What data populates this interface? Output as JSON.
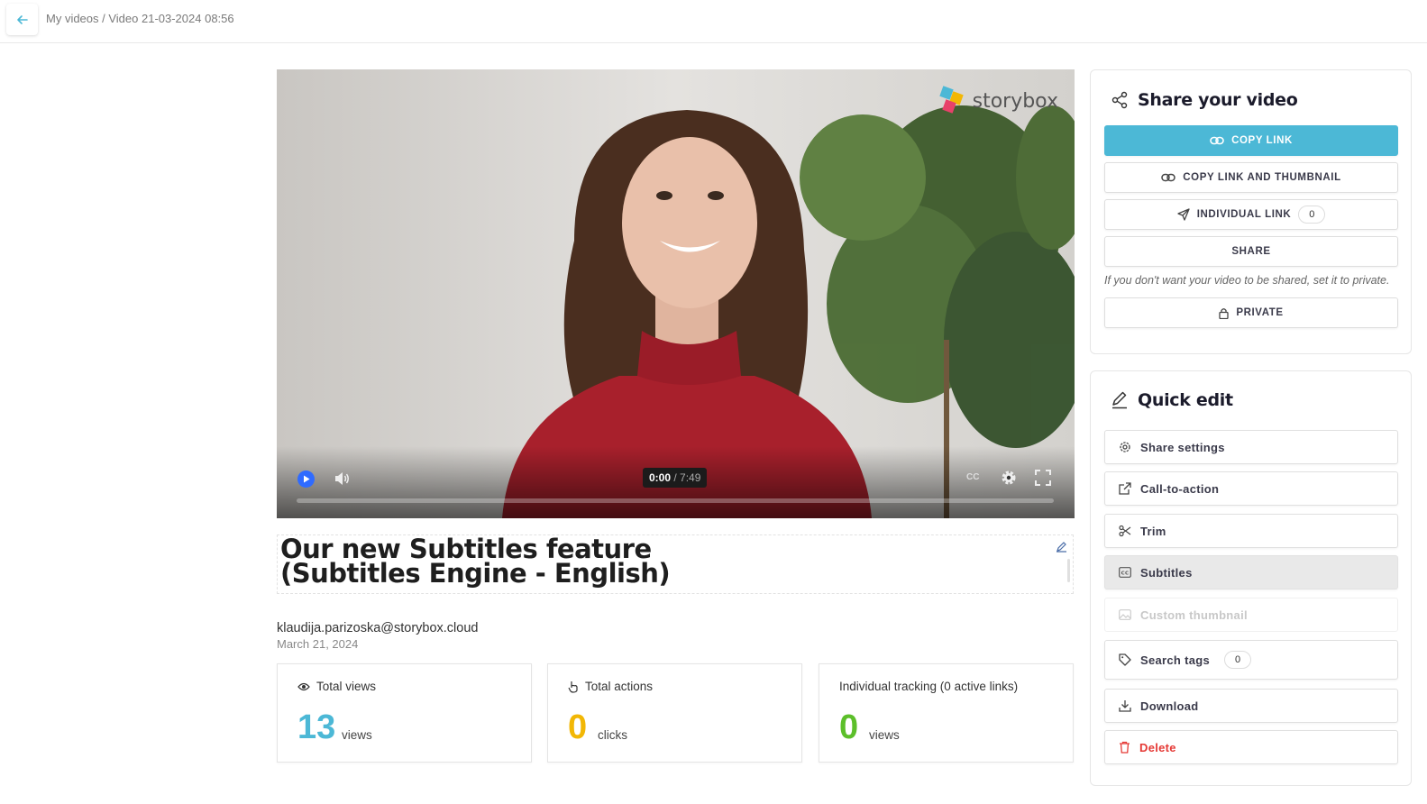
{
  "breadcrumb": {
    "text": "My videos / Video 21-03-2024 08:56"
  },
  "video": {
    "logo_text": "storybox",
    "current_time": "0:00",
    "duration": "/ 7:49",
    "cc_label": "CC",
    "progress": 0
  },
  "title": {
    "line1": "Our new Subtitles feature",
    "line2": "(Subtitles Engine - English)"
  },
  "meta": {
    "author": "klaudija.parizoska@storybox.cloud",
    "date": "March 21, 2024"
  },
  "stats": [
    {
      "label": "Total views",
      "value": "13",
      "unit": "views",
      "color": "#4cb8d6",
      "icon": "eye-icon"
    },
    {
      "label": "Total actions",
      "value": "0",
      "unit": "clicks",
      "color": "#f2b705",
      "icon": "pointer-icon"
    },
    {
      "label": "Individual tracking (0 active links)",
      "value": "0",
      "unit": "views",
      "color": "#5cbf2a",
      "icon": ""
    }
  ],
  "share": {
    "heading": "Share your video",
    "copy_link": "COPY LINK",
    "copy_link_thumb": "COPY LINK AND THUMBNAIL",
    "individual_link": "INDIVIDUAL LINK",
    "individual_count": "0",
    "share": "SHARE",
    "private_note": "If you don't want your video to be shared, set it to private.",
    "private": "PRIVATE"
  },
  "quick_edit": {
    "heading": "Quick edit",
    "items": [
      {
        "label": "Share settings",
        "icon": "gear-icon"
      },
      {
        "label": "Call-to-action",
        "icon": "external-link-icon"
      },
      {
        "label": "Trim",
        "icon": "scissors-icon"
      },
      {
        "label": "Subtitles",
        "icon": "cc-icon"
      },
      {
        "label": "Custom thumbnail",
        "icon": "image-icon"
      },
      {
        "label": "Search tags",
        "icon": "tag-icon",
        "count": "0"
      },
      {
        "label": "Download",
        "icon": "download-icon"
      },
      {
        "label": "Delete",
        "icon": "trash-icon"
      }
    ]
  },
  "colors": {
    "accent": "#4cb8d6",
    "player_blue": "#2f6bff",
    "danger": "#e53935"
  }
}
